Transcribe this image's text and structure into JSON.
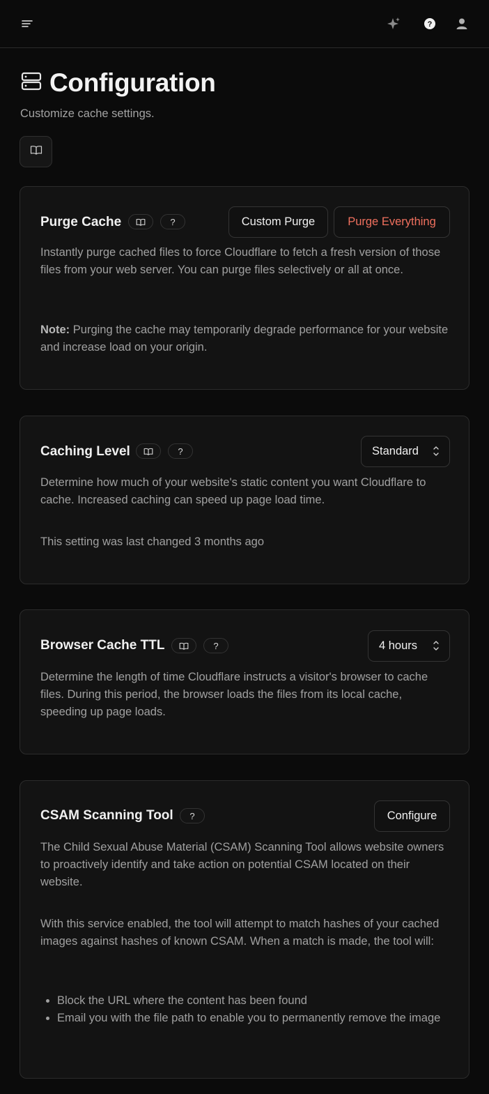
{
  "page": {
    "title": "Configuration",
    "subtitle": "Customize cache settings."
  },
  "icons": {
    "menu": "menu-lines-icon",
    "sparkle": "sparkle-icon",
    "help": "question-circle-icon",
    "user": "user-icon",
    "server": "server-icon",
    "book": "book-open-icon",
    "chevrons": "chevron-up-down-icon"
  },
  "colors": {
    "background": "#0b0b0b",
    "card": "#131313",
    "danger": "#f0705e"
  },
  "cards": {
    "purge": {
      "title": "Purge Cache",
      "help": "?",
      "custom_label": "Custom Purge",
      "everything_label": "Purge Everything",
      "desc": "Instantly purge cached files to force Cloudflare to fetch a fresh version of those files from your web server. You can purge files selectively or all at once.",
      "note_label": "Note:",
      "note_text": "Purging the cache may temporarily degrade performance for your website and increase load on your origin."
    },
    "caching_level": {
      "title": "Caching Level",
      "help": "?",
      "value": "Standard",
      "desc": "Determine how much of your website's static content you want Cloudflare to cache. Increased caching can speed up page load time.",
      "changed": "This setting was last changed 3 months ago"
    },
    "browser_ttl": {
      "title": "Browser Cache TTL",
      "help": "?",
      "value": "4 hours",
      "desc": "Determine the length of time Cloudflare instructs a visitor's browser to cache files. During this period, the browser loads the files from its local cache, speeding up page loads."
    },
    "csam": {
      "title": "CSAM Scanning Tool",
      "help": "?",
      "configure_label": "Configure",
      "desc": "The Child Sexual Abuse Material (CSAM) Scanning Tool allows website owners to proactively identify and take action on potential CSAM located on their website.",
      "desc2": "With this service enabled, the tool will attempt to match hashes of your cached images against hashes of known CSAM. When a match is made, the tool will:",
      "bullets": [
        "Block the URL where the content has been found",
        "Email you with the file path to enable you to permanently remove the image"
      ]
    }
  }
}
